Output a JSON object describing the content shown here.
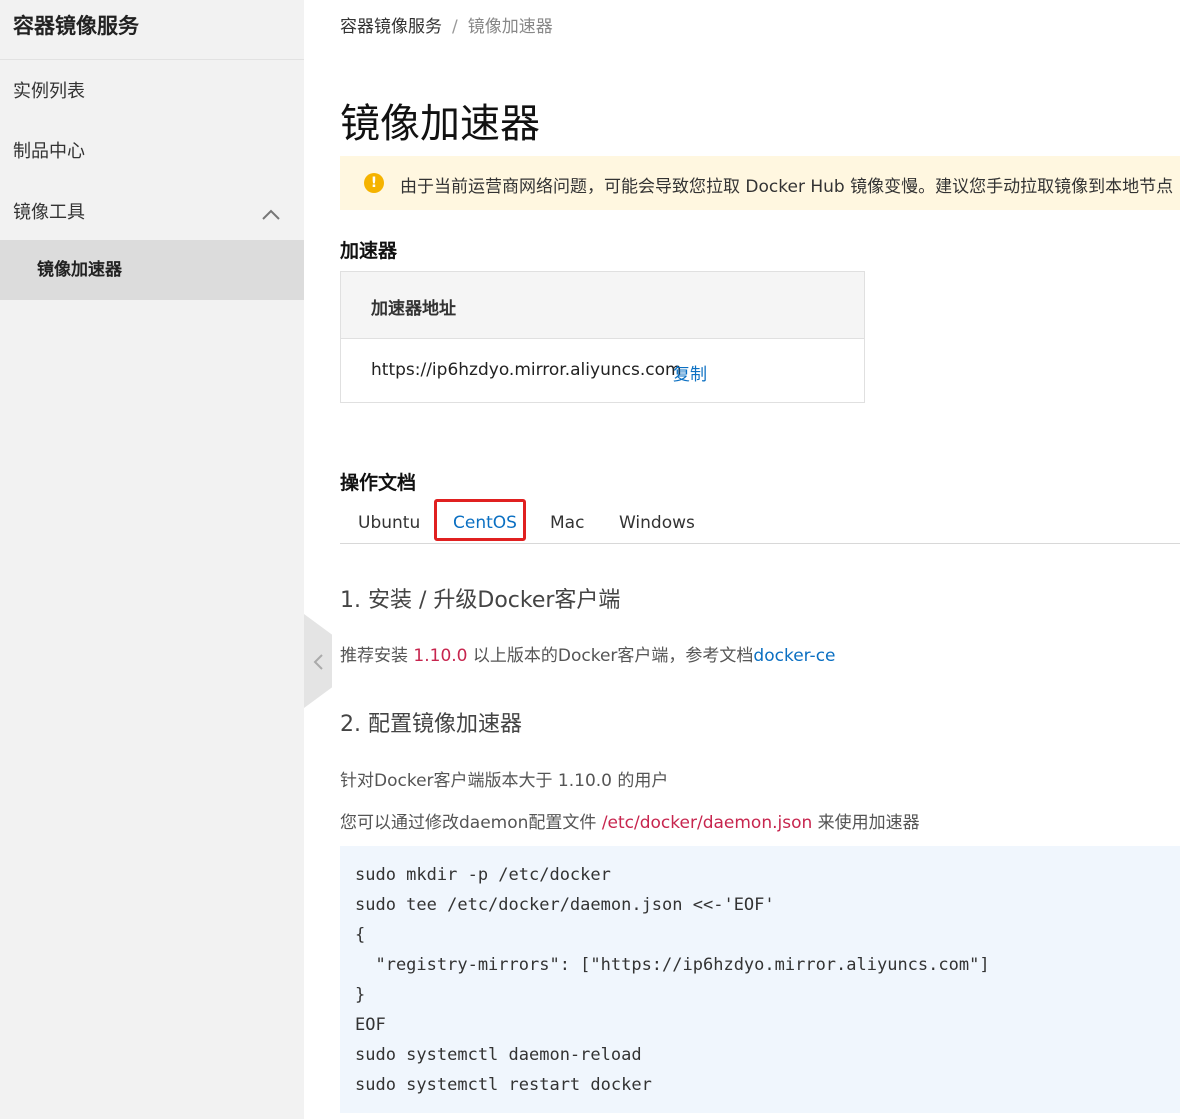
{
  "sidebar": {
    "title": "容器镜像服务",
    "items": [
      {
        "label": "实例列表"
      },
      {
        "label": "制品中心"
      }
    ],
    "group": {
      "label": "镜像工具",
      "icon": "chevron-up-icon"
    },
    "active_item": {
      "label": "镜像加速器"
    }
  },
  "breadcrumb": {
    "root": "容器镜像服务",
    "separator": "/",
    "current": "镜像加速器"
  },
  "page_title": "镜像加速器",
  "notice": {
    "icon": "warning-icon",
    "text": "由于当前运营商网络问题，可能会导致您拉取 Docker Hub 镜像变慢。建议您手动拉取镜像到本地节点"
  },
  "accelerator": {
    "section_title": "加速器",
    "header": "加速器地址",
    "url": "https://ip6hzdyo.mirror.aliyuncs.com",
    "copy_label": "复制"
  },
  "docs": {
    "section_title": "操作文档",
    "tabs": [
      {
        "label": "Ubuntu"
      },
      {
        "label": "CentOS"
      },
      {
        "label": "Mac"
      },
      {
        "label": "Windows"
      }
    ],
    "active_tab": "CentOS",
    "step1": {
      "title": "1. 安装 / 升级Docker客户端",
      "text_before": "推荐安装 ",
      "version": "1.10.0",
      "text_after": " 以上版本的Docker客户端，参考文档",
      "link": "docker-ce"
    },
    "step2": {
      "title": "2. 配置镜像加速器",
      "line1": "针对Docker客户端版本大于 1.10.0 的用户",
      "line2_before": "您可以通过修改daemon配置文件 ",
      "path": "/etc/docker/daemon.json",
      "line2_after": " 来使用加速器"
    },
    "code": "sudo mkdir -p /etc/docker\nsudo tee /etc/docker/daemon.json <<-'EOF'\n{\n  \"registry-mirrors\": [\"https://ip6hzdyo.mirror.aliyuncs.com\"]\n}\nEOF\nsudo systemctl daemon-reload\nsudo systemctl restart docker"
  },
  "colors": {
    "accent": "#0a6fc2",
    "highlight_red": "#c7254e",
    "notice_bg": "#fff7e0",
    "tab_highlight_border": "#e02020"
  }
}
